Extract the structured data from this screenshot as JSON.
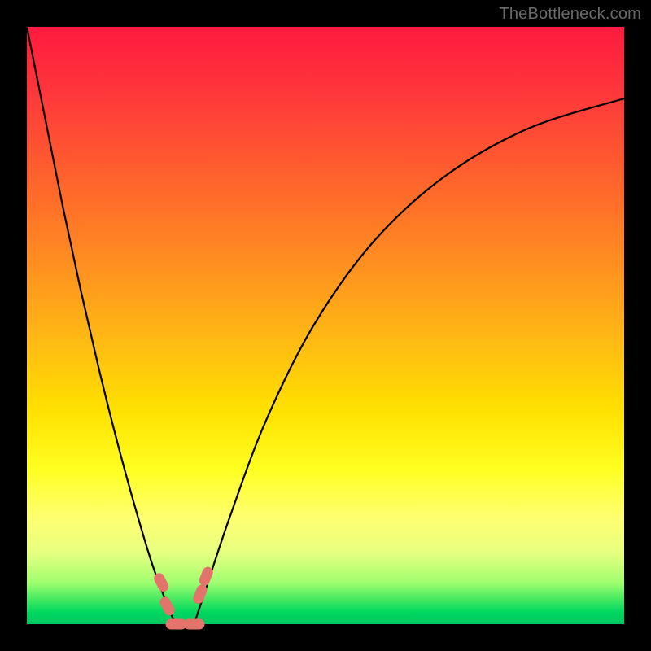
{
  "watermark": "TheBottleneck.com",
  "chart_data": {
    "type": "line",
    "title": "",
    "xlabel": "",
    "ylabel": "",
    "xlim": [
      0,
      100
    ],
    "ylim": [
      0,
      100
    ],
    "grid": false,
    "legend": false,
    "series": [
      {
        "name": "left-curve",
        "x": [
          0,
          3,
          6,
          9,
          12,
          15,
          18,
          21,
          24,
          25
        ],
        "y": [
          100,
          85,
          70,
          56,
          43,
          31,
          20,
          10,
          2,
          0
        ]
      },
      {
        "name": "right-curve",
        "x": [
          28,
          30,
          34,
          40,
          48,
          58,
          70,
          84,
          100
        ],
        "y": [
          0,
          6,
          18,
          34,
          50,
          64,
          75,
          83,
          88
        ]
      }
    ],
    "markers": [
      {
        "name": "left-marker-upper",
        "x": 22.5,
        "y": 7
      },
      {
        "name": "left-marker-lower",
        "x": 23.5,
        "y": 3
      },
      {
        "name": "right-marker-upper",
        "x": 30.0,
        "y": 8
      },
      {
        "name": "right-marker-lower",
        "x": 29.0,
        "y": 5
      },
      {
        "name": "bottom-marker-left",
        "x": 25.0,
        "y": 0
      },
      {
        "name": "bottom-marker-right",
        "x": 28.0,
        "y": 0
      }
    ]
  }
}
